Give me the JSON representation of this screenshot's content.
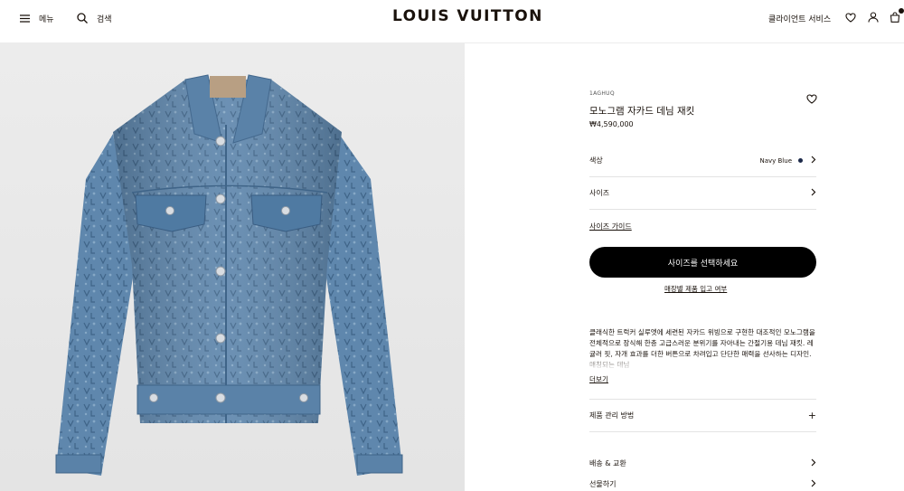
{
  "header": {
    "menu_label": "메뉴",
    "search_label": "검색",
    "logo": "LOUIS VUITTON",
    "client_service": "클라이언트 서비스"
  },
  "product": {
    "sku": "1AGHUQ",
    "name": "모노그램 자카드 데님 재킷",
    "price": "₩4,590,000",
    "color_label": "색상",
    "color_value": "Navy Blue",
    "color_swatch": "#1d2a4a",
    "size_label": "사이즈",
    "size_guide": "사이즈 가이드",
    "select_size_button": "사이즈를 선택하세요",
    "store_stock_link": "매장별 제품 입고 여부",
    "description": "클래식한 트럭커 실루엣에 세련된 자카드 위빙으로 구현한 대조적인 모노그램을 전체적으로 장식해 한층 고급스러운 분위기를 자아내는 간절기용 데님 재킷. 레귤러 핏, 자개 효과를 더한 버튼으로 차려입고 단단한 매력을 선사하는 디자인. 매칭되는 데님",
    "more_link": "더보기",
    "care_label": "제품 관리 방법",
    "shipping_label": "배송 & 교환",
    "gift_label": "선물하기"
  },
  "icons": {
    "menu": "hamburger-icon",
    "search": "search-icon",
    "wishlist": "heart-icon",
    "account": "user-icon",
    "bag": "shopping-bag-icon"
  }
}
